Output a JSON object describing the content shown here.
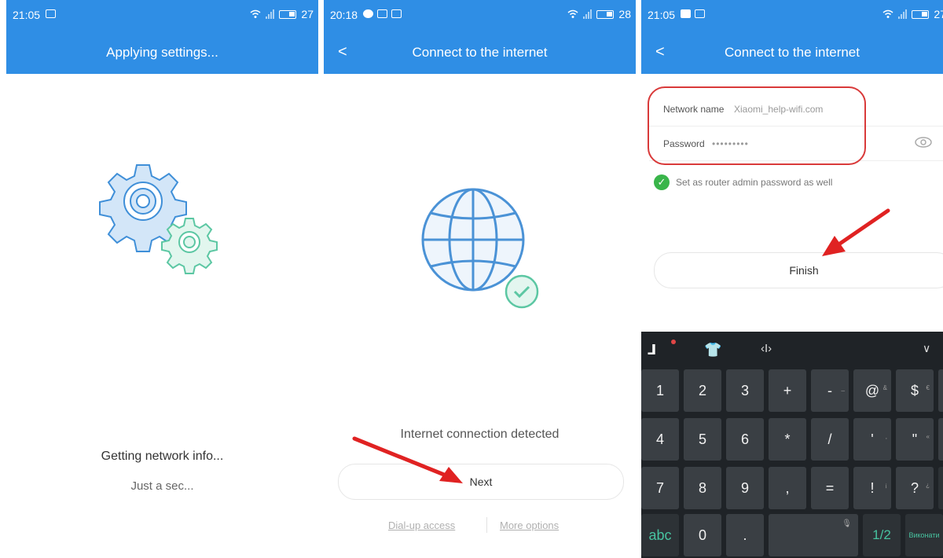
{
  "panels": [
    {
      "status_time": "21:05",
      "battery": "27",
      "title": "Applying settings...",
      "message_primary": "Getting network info...",
      "message_secondary": "Just a sec..."
    },
    {
      "status_time": "20:18",
      "battery": "28",
      "title": "Connect to the internet",
      "back_label": "<",
      "message": "Internet connection detected",
      "next_label": "Next",
      "link_dialup": "Dial-up access",
      "link_more": "More options"
    },
    {
      "status_time": "21:05",
      "battery": "27",
      "title": "Connect to the internet",
      "back_label": "<",
      "network_name_label": "Network name",
      "network_name_value": "Xiaomi_help-wifi.com",
      "password_label": "Password",
      "password_value": "•••••••••",
      "admin_checkbox_label": "Set as router admin password as well",
      "finish_label": "Finish"
    }
  ],
  "keyboard": {
    "rows": [
      [
        {
          "k": "1"
        },
        {
          "k": "2"
        },
        {
          "k": "3"
        },
        {
          "k": "+"
        },
        {
          "k": "-",
          "s": "_"
        },
        {
          "k": "@",
          "s": "&"
        },
        {
          "k": "$",
          "s": "€"
        },
        {
          "k": "(",
          "s": "<"
        },
        {
          "k": ")"
        }
      ],
      [
        {
          "k": "4"
        },
        {
          "k": "5"
        },
        {
          "k": "6"
        },
        {
          "k": "*"
        },
        {
          "k": "/"
        },
        {
          "k": "'",
          "s": ","
        },
        {
          "k": "\"",
          "s": "«"
        },
        {
          "k": ":",
          "s": ";"
        },
        {
          "k": "#"
        }
      ],
      [
        {
          "k": "7"
        },
        {
          "k": "8"
        },
        {
          "k": "9"
        },
        {
          "k": ","
        },
        {
          "k": "="
        },
        {
          "k": "!",
          "s": "¡"
        },
        {
          "k": "?",
          "s": "¿"
        },
        {
          "k": "⌫",
          "wide": true
        }
      ]
    ],
    "bottom": {
      "abc": "abc",
      "zero": "0",
      "dot": ".",
      "page": "1/2",
      "enter": "Виконати"
    }
  },
  "colors": {
    "accent": "#2f8ee5",
    "highlight": "#d93a3a",
    "check": "#39b54a"
  }
}
